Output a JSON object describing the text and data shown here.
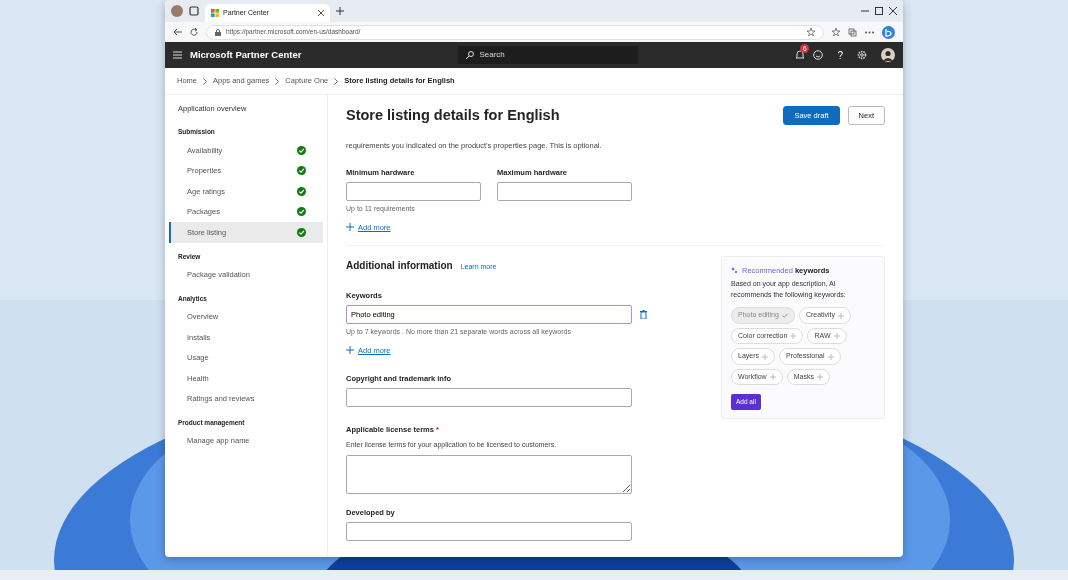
{
  "browser": {
    "tab_title": "Partner Center",
    "url": "https://partner.microsoft.com/en-us/dashboard/"
  },
  "app": {
    "title": "Microsoft Partner Center",
    "search_placeholder": "Search",
    "notification_count": "6",
    "help": "?"
  },
  "breadcrumb": [
    {
      "label": "Home"
    },
    {
      "label": "Apps and games"
    },
    {
      "label": "Capture One"
    },
    {
      "label": "Store listing details for English"
    }
  ],
  "sidebar": {
    "top_item": "Application overview",
    "sections": [
      {
        "title": "Submission",
        "items": [
          {
            "label": "Availability",
            "completed": true,
            "selected": false
          },
          {
            "label": "Properties",
            "completed": true,
            "selected": false
          },
          {
            "label": "Age ratings",
            "completed": true,
            "selected": false
          },
          {
            "label": "Packages",
            "completed": true,
            "selected": false
          },
          {
            "label": "Store listing",
            "completed": true,
            "selected": true
          }
        ]
      },
      {
        "title": "Review",
        "items": [
          {
            "label": "Package validation",
            "completed": false,
            "selected": false
          }
        ]
      },
      {
        "title": "Analytics",
        "items": [
          {
            "label": "Overview",
            "completed": false,
            "selected": false
          },
          {
            "label": "Installs",
            "completed": false,
            "selected": false
          },
          {
            "label": "Usage",
            "completed": false,
            "selected": false
          },
          {
            "label": "Health",
            "completed": false,
            "selected": false
          },
          {
            "label": "Ratings and reviews",
            "completed": false,
            "selected": false
          }
        ]
      },
      {
        "title": "Product management",
        "items": [
          {
            "label": "Manage app name",
            "completed": false,
            "selected": false
          }
        ]
      }
    ]
  },
  "page": {
    "title": "Store listing details for English",
    "buttons": [
      {
        "label": "Save draft",
        "kind": "primary"
      },
      {
        "label": "Next",
        "kind": "secondary"
      }
    ]
  },
  "requirements": {
    "description": "requirements you indicated on the product's properties page. This is optional.",
    "fields": [
      {
        "label": "Minimum hardware"
      },
      {
        "label": "Maximum hardware"
      }
    ],
    "hint": "Up to 11 requirements",
    "add_more": "Add more"
  },
  "additional": {
    "title": "Additional information",
    "learn_more": "Learn more",
    "keywords": {
      "label": "Keywords",
      "value": "Photo editing",
      "hint": "Up to 7 keywords . No more than 21 separate words across all keywords",
      "add_more": "Add more"
    },
    "copyright": {
      "label": "Copyright and trademark info"
    },
    "license": {
      "label": "Applicable license terms",
      "required_mark": "*",
      "description": "Enter license terms for your application to be licensed to customers."
    },
    "developed_by": {
      "label": "Developed by"
    }
  },
  "recommended": {
    "title": "**Recommended** keywords",
    "description": "Based on your app description, AI recommends the following keywords:",
    "chips": [
      {
        "label": "Photo editing",
        "added": true
      },
      {
        "label": "Creativity",
        "added": false
      },
      {
        "label": "Color correction",
        "added": false
      },
      {
        "label": "RAW",
        "added": false
      },
      {
        "label": "Layers",
        "added": false
      },
      {
        "label": "Professional",
        "added": false
      },
      {
        "label": "Workflow",
        "added": false
      },
      {
        "label": "Masks",
        "added": false
      }
    ],
    "button": "Add all"
  }
}
